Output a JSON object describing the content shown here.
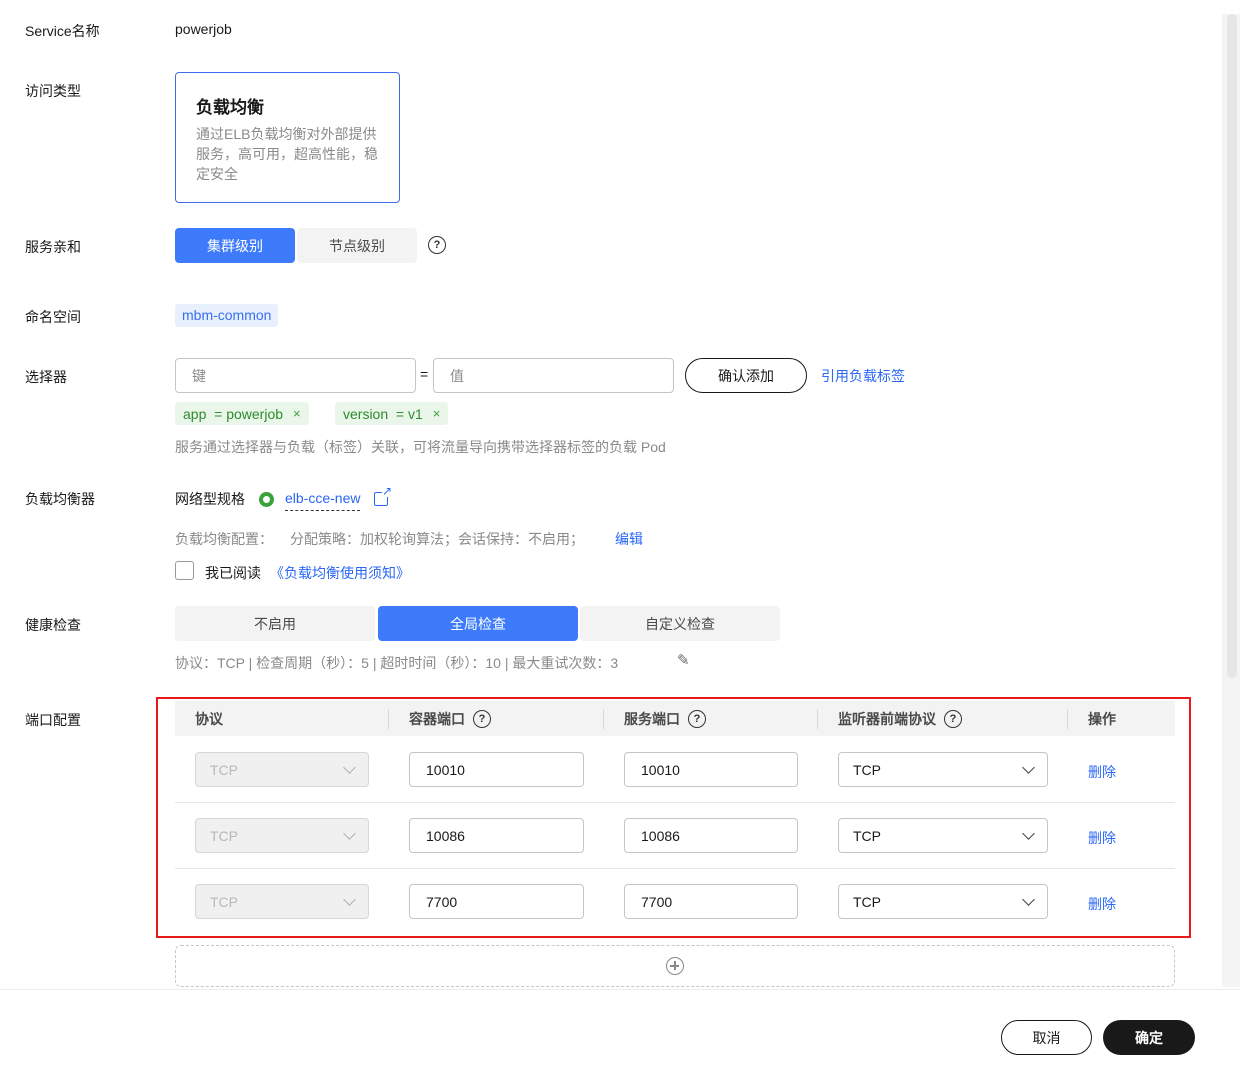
{
  "form": {
    "service_name": {
      "label": "Service名称",
      "value": "powerjob"
    },
    "access_type": {
      "label": "访问类型",
      "card_title": "负载均衡",
      "card_desc": "通过ELB负载均衡对外部提供服务，高可用，超高性能，稳定安全"
    },
    "affinity": {
      "label": "服务亲和",
      "options": [
        "集群级别",
        "节点级别"
      ],
      "selected": "集群级别"
    },
    "namespace": {
      "label": "命名空间",
      "value": "mbm-common"
    },
    "selector": {
      "label": "选择器",
      "key_placeholder": "键",
      "equals": "=",
      "value_placeholder": "值",
      "confirm_label": "确认添加",
      "reference_link": "引用负载标签",
      "tags": [
        "app  = powerjob",
        "version  = v1"
      ],
      "tag_close": "×",
      "hint": "服务通过选择器与负载（标签）关联，可将流量导向携带选择器标签的负载 Pod"
    },
    "load_balancer": {
      "label": "负载均衡器",
      "spec_label": "网络型规格",
      "elb_name": "elb-cce-new",
      "config_prefix": "负载均衡配置：",
      "config_text": "分配策略：加权轮询算法；会话保持：不启用；",
      "edit_label": "编辑",
      "agree_prefix": "我已阅读",
      "agree_link": "《负载均衡使用须知》"
    },
    "health_check": {
      "label": "健康检查",
      "options": [
        "不启用",
        "全局检查",
        "自定义检查"
      ],
      "selected": "全局检查",
      "summary": "协议：TCP | 检查周期（秒）：5 | 超时时间（秒）：10 | 最大重试次数：3"
    },
    "ports": {
      "label": "端口配置",
      "headers": [
        "协议",
        "容器端口",
        "服务端口",
        "监听器前端协议",
        "操作"
      ],
      "rows": [
        {
          "protocol": "TCP",
          "container_port": "10010",
          "service_port": "10010",
          "listener_protocol": "TCP",
          "action": "删除"
        },
        {
          "protocol": "TCP",
          "container_port": "10086",
          "service_port": "10086",
          "listener_protocol": "TCP",
          "action": "删除"
        },
        {
          "protocol": "TCP",
          "container_port": "7700",
          "service_port": "7700",
          "listener_protocol": "TCP",
          "action": "删除"
        }
      ]
    }
  },
  "footer": {
    "cancel_label": "取消",
    "ok_label": "确定"
  },
  "icons": {
    "help": "question-circle-icon",
    "close": "close-icon",
    "external": "external-link-icon",
    "edit": "pencil-icon",
    "add": "plus-circle-icon",
    "status": "status-ring-icon",
    "chevron": "chevron-down-icon"
  },
  "colors": {
    "primary": "#3e7bfa",
    "link": "#2a67f5",
    "tag_green": "#2e8b2e",
    "highlight_border": "#e8191a"
  }
}
